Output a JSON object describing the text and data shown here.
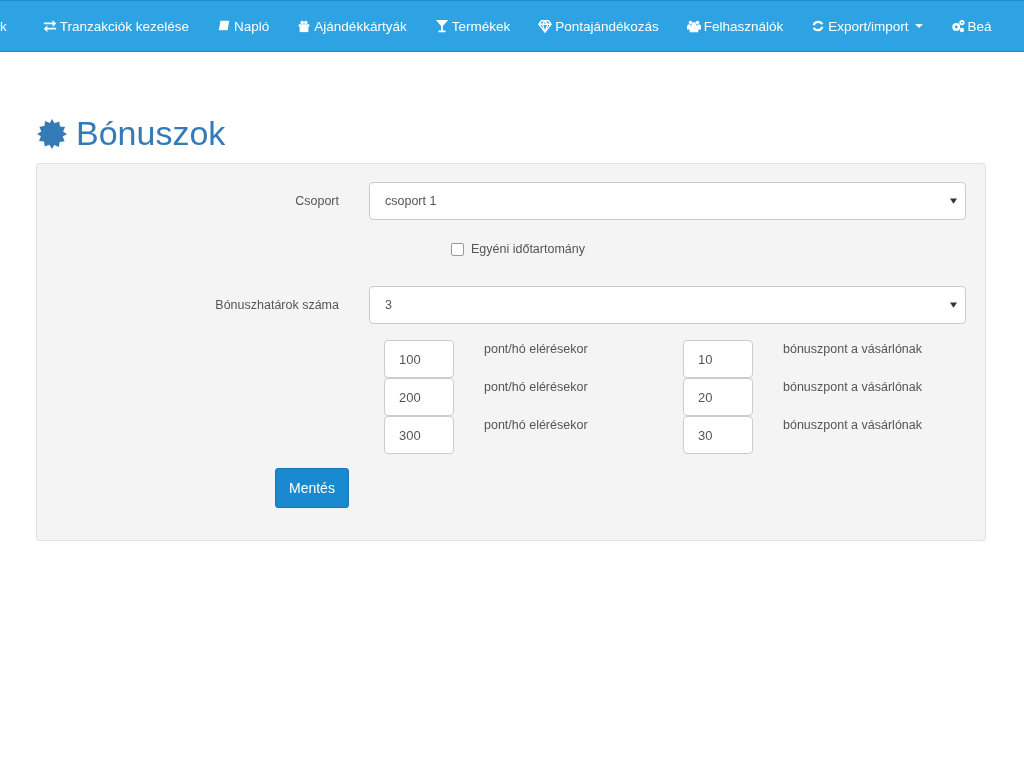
{
  "navbar": {
    "items": [
      {
        "label": "k",
        "kind": "plain",
        "dropdown": false
      },
      {
        "label": "Tranzakciók kezelése",
        "kind": "exchange",
        "dropdown": false
      },
      {
        "label": "Napló",
        "kind": "book",
        "dropdown": false
      },
      {
        "label": "Ajándékkártyák",
        "kind": "gift",
        "dropdown": false
      },
      {
        "label": "Termékek",
        "kind": "filter",
        "dropdown": false
      },
      {
        "label": "Pontajándékozás",
        "kind": "diamond",
        "dropdown": false
      },
      {
        "label": "Felhasználók",
        "kind": "users",
        "dropdown": false
      },
      {
        "label": "Export/import",
        "kind": "refresh",
        "dropdown": true
      },
      {
        "label": "Beá",
        "kind": "cogs",
        "dropdown": false
      }
    ]
  },
  "page": {
    "title": "Bónuszok"
  },
  "form": {
    "group_label": "Csoport",
    "group_value": "csoport 1",
    "custom_range": {
      "label": "Egyéni időtartomány",
      "checked": false
    },
    "count_label": "Bónuszhatárok száma",
    "count_value": "3",
    "thresholds": [
      {
        "points": "100",
        "points_label": "pont/hó elérésekor",
        "bonus": "10",
        "bonus_label": "bónuszpont a vásárlónak"
      },
      {
        "points": "200",
        "points_label": "pont/hó elérésekor",
        "bonus": "20",
        "bonus_label": "bónuszpont a vásárlónak"
      },
      {
        "points": "300",
        "points_label": "pont/hó elérésekor",
        "bonus": "30",
        "bonus_label": "bónuszpont a vásárlónak"
      }
    ],
    "save_button": "Mentés"
  }
}
